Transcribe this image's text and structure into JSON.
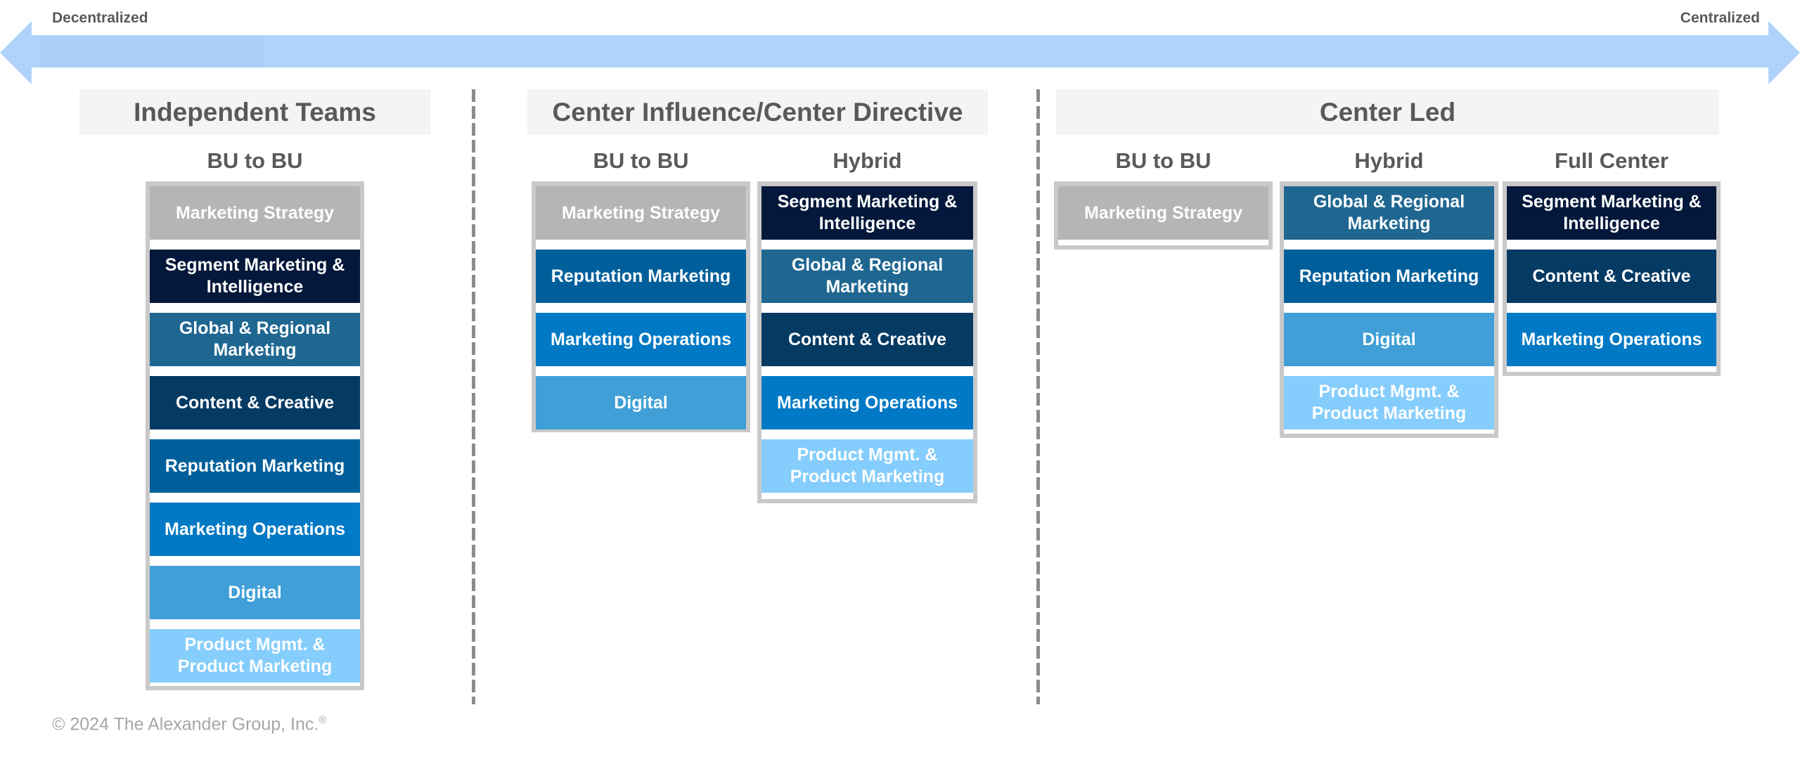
{
  "axis": {
    "left_label": "Decentralized",
    "right_label": "Centralized",
    "arrow_color": "#b0d3fb"
  },
  "colors": {
    "marketing_strategy": "#b5b5b5",
    "segment_marketing": "#03183a",
    "global_regional": "#1f6791",
    "content_creative": "#053a63",
    "reputation": "#005f9b",
    "operations": "#0279c4",
    "digital": "#3f9fd6",
    "product": "#85cdfc"
  },
  "sections": [
    {
      "title": "Independent Teams",
      "columns": [
        {
          "label": "BU to BU",
          "tiles": [
            {
              "text": "Marketing Strategy",
              "color": "marketing_strategy"
            },
            {
              "text": "Segment Marketing & Intelligence",
              "color": "segment_marketing"
            },
            {
              "text": "Global & Regional Marketing",
              "color": "global_regional"
            },
            {
              "text": "Content & Creative",
              "color": "content_creative"
            },
            {
              "text": "Reputation Marketing",
              "color": "reputation"
            },
            {
              "text": "Marketing Operations",
              "color": "operations"
            },
            {
              "text": "Digital",
              "color": "digital"
            },
            {
              "text": "Product Mgmt. & Product Marketing",
              "color": "product"
            }
          ]
        }
      ]
    },
    {
      "title": "Center Influence/Center Directive",
      "columns": [
        {
          "label": "BU to BU",
          "tiles": [
            {
              "text": "Marketing Strategy",
              "color": "marketing_strategy"
            },
            {
              "text": "Reputation Marketing",
              "color": "reputation"
            },
            {
              "text": "Marketing Operations",
              "color": "operations"
            },
            {
              "text": "Digital",
              "color": "digital"
            }
          ]
        },
        {
          "label": "Hybrid",
          "tiles": [
            {
              "text": "Segment Marketing & Intelligence",
              "color": "segment_marketing"
            },
            {
              "text": "Global & Regional Marketing",
              "color": "global_regional"
            },
            {
              "text": "Content & Creative",
              "color": "content_creative"
            },
            {
              "text": "Marketing Operations",
              "color": "operations"
            },
            {
              "text": "Product Mgmt. & Product Marketing",
              "color": "product"
            }
          ]
        }
      ]
    },
    {
      "title": "Center Led",
      "columns": [
        {
          "label": "BU to BU",
          "tiles": [
            {
              "text": "Marketing Strategy",
              "color": "marketing_strategy"
            }
          ]
        },
        {
          "label": "Hybrid",
          "tiles": [
            {
              "text": "Global & Regional Marketing",
              "color": "global_regional"
            },
            {
              "text": "Reputation Marketing",
              "color": "reputation"
            },
            {
              "text": "Digital",
              "color": "digital"
            },
            {
              "text": "Product Mgmt. & Product Marketing",
              "color": "product"
            }
          ]
        },
        {
          "label": "Full Center",
          "tiles": [
            {
              "text": "Segment Marketing & Intelligence",
              "color": "segment_marketing"
            },
            {
              "text": "Content & Creative",
              "color": "content_creative"
            },
            {
              "text": "Marketing Operations",
              "color": "operations"
            }
          ]
        }
      ]
    }
  ],
  "footer": {
    "copyright": "© 2024 The Alexander Group, Inc.",
    "registered_mark": "®"
  }
}
